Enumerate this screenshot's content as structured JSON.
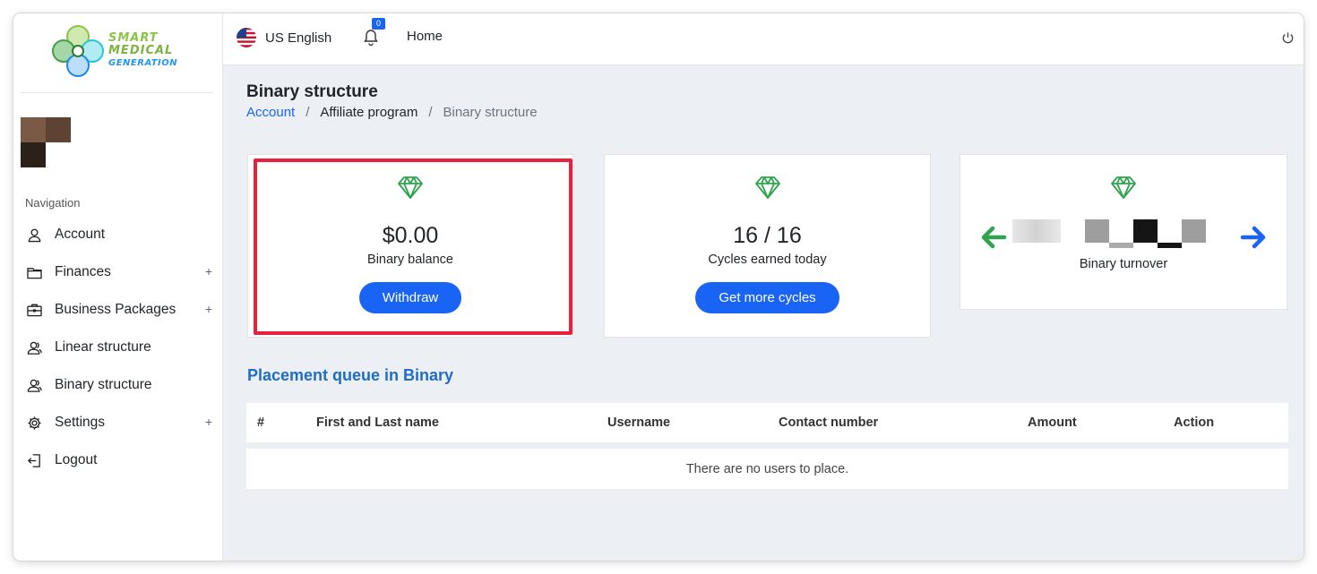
{
  "sidebar": {
    "logo": {
      "line1": "SMART",
      "line2": "MEDICAL",
      "line3": "GENERATION"
    },
    "nav_heading": "Navigation",
    "items": [
      {
        "label": "Account",
        "icon": "user-icon",
        "expandable": false
      },
      {
        "label": "Finances",
        "icon": "folder-icon",
        "expandable": true
      },
      {
        "label": "Business Packages",
        "icon": "briefcase-icon",
        "expandable": true
      },
      {
        "label": "Linear structure",
        "icon": "users-icon",
        "expandable": false
      },
      {
        "label": "Binary structure",
        "icon": "users-icon",
        "expandable": false
      },
      {
        "label": "Settings",
        "icon": "gear-icon",
        "expandable": true
      },
      {
        "label": "Logout",
        "icon": "logout-icon",
        "expandable": false
      }
    ],
    "expand_symbol": "+"
  },
  "topbar": {
    "language": "US English",
    "notification_count": "0",
    "home_label": "Home"
  },
  "page": {
    "title": "Binary structure",
    "breadcrumb": {
      "link": "Account",
      "middle": "Affiliate program",
      "current": "Binary structure",
      "separator": "/"
    }
  },
  "cards": {
    "balance": {
      "value": "$0.00",
      "caption": "Binary balance",
      "button": "Withdraw"
    },
    "cycles": {
      "value": "16 / 16",
      "caption": "Cycles earned today",
      "button": "Get more cycles"
    },
    "turnover": {
      "caption": "Binary turnover"
    }
  },
  "queue": {
    "title": "Placement queue in Binary",
    "columns": [
      "#",
      "First and Last name",
      "Username",
      "Contact number",
      "Amount",
      "Action"
    ],
    "empty_text": "There are no users to place."
  },
  "colors": {
    "accent": "#1a64f5",
    "gem": "#2ea44f",
    "highlight": "#e8203c",
    "section_title": "#1f6cc9"
  }
}
